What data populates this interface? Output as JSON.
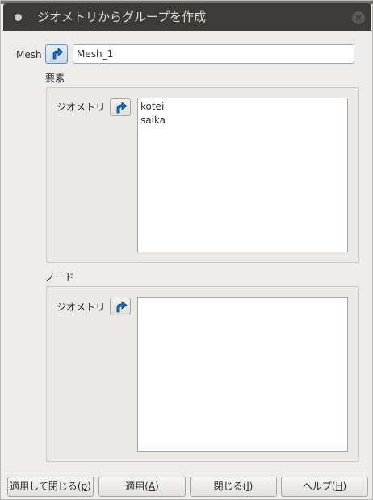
{
  "window": {
    "title": "ジオメトリからグループを作成"
  },
  "mesh": {
    "label": "Mesh",
    "value": "Mesh_1"
  },
  "elements_section": {
    "label": "要素",
    "geometry_label": "ジオメトリ",
    "items": [
      "kotei",
      "saika"
    ]
  },
  "nodes_section": {
    "label": "ノード",
    "geometry_label": "ジオメトリ",
    "items": []
  },
  "buttons": {
    "apply_close": {
      "label": "適用して閉じる(",
      "mnemonic": "p",
      "suffix": ")"
    },
    "apply": {
      "label": "適用(",
      "mnemonic": "A",
      "suffix": ")"
    },
    "close": {
      "label": "閉じる(",
      "mnemonic": "l",
      "suffix": ")"
    },
    "help": {
      "label": "ヘルプ(",
      "mnemonic": "H",
      "suffix": ")"
    }
  },
  "icons": {
    "selection_arrow": "selection-arrow-icon",
    "window_menu": "window-menu-icon",
    "close": "close-icon"
  },
  "colors": {
    "titlebar": "#3c3b37",
    "dialog_bg": "#edecea",
    "arrow_blue": "#1f6fbf"
  }
}
